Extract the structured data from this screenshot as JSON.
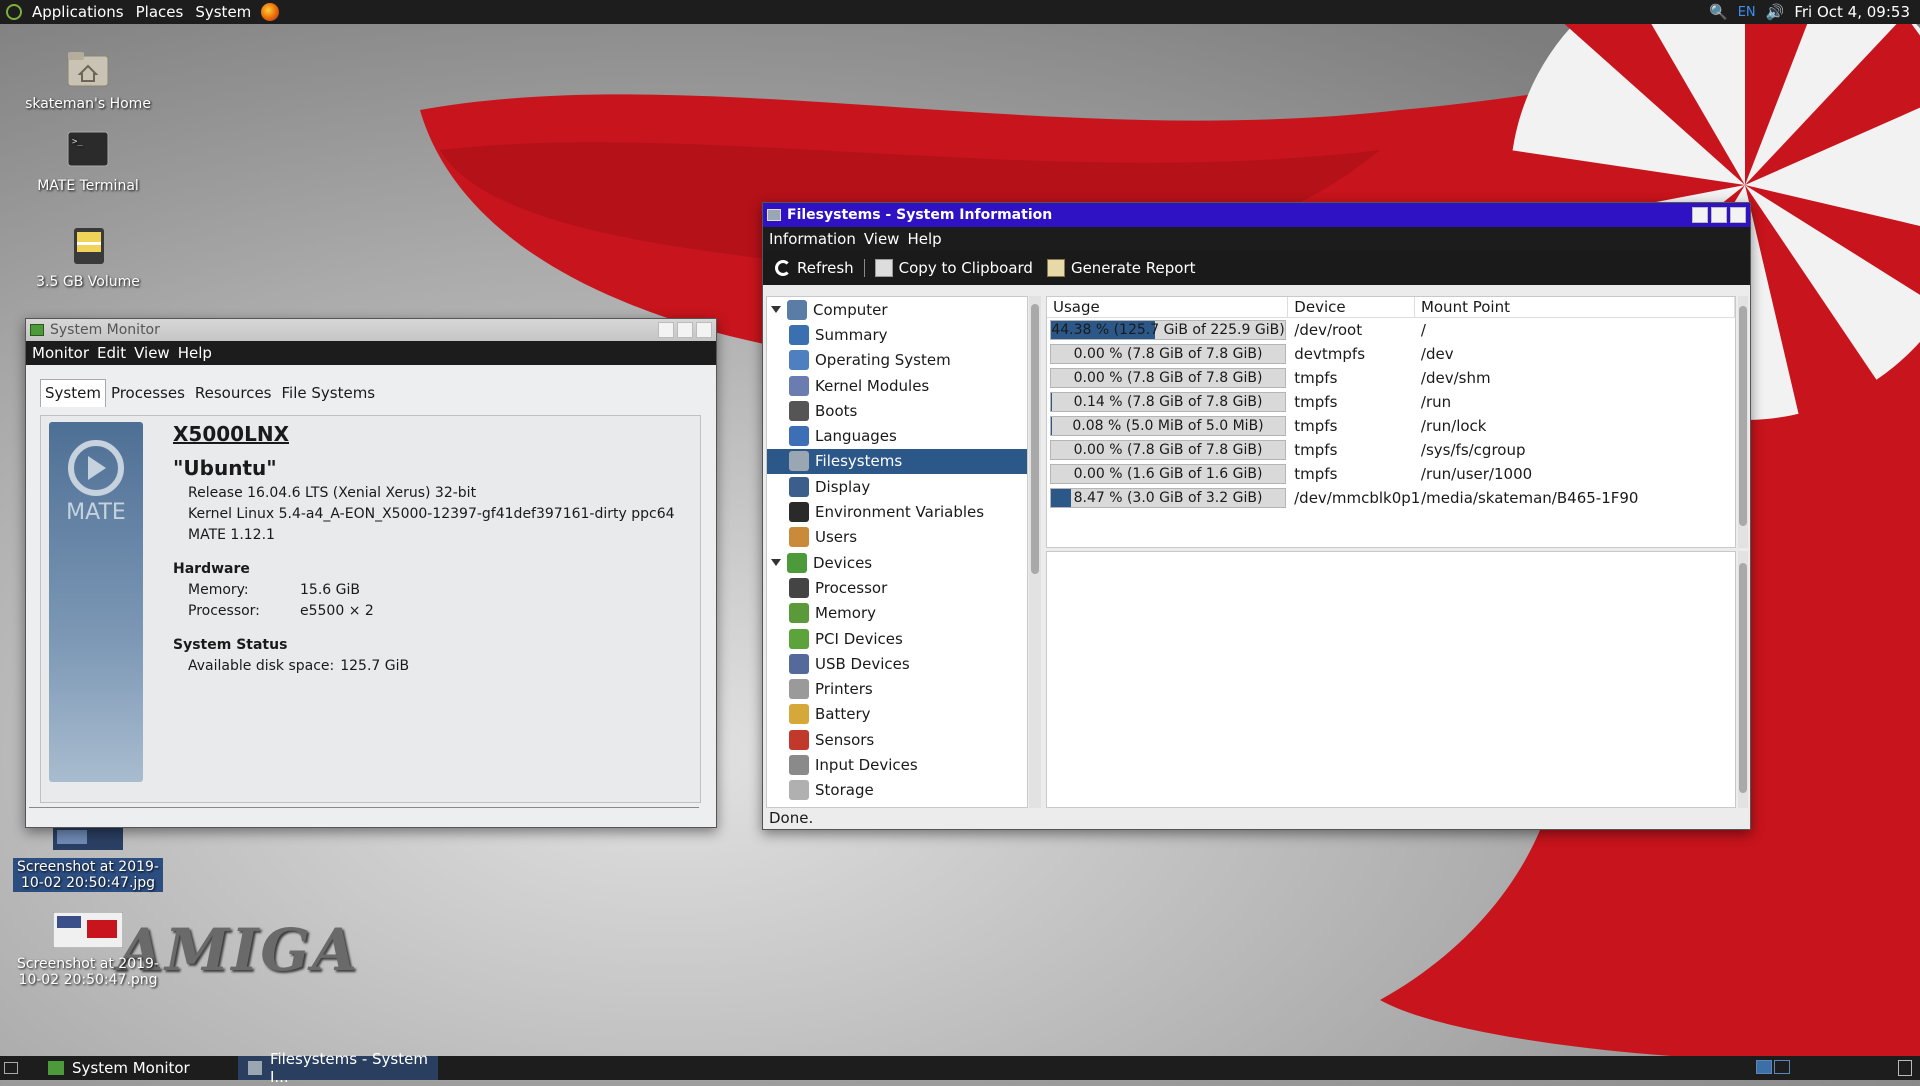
{
  "top_panel": {
    "menus": [
      "Applications",
      "Places",
      "System"
    ],
    "keyboard_layout": "EN",
    "clock": "Fri Oct  4, 09:53"
  },
  "desktop": {
    "icons": [
      {
        "label": "skateman's Home"
      },
      {
        "label": "MATE Terminal"
      },
      {
        "label": "3.5 GB Volume"
      },
      {
        "label": "Screenshot at 2019-10-02 20:50:47.jpg"
      },
      {
        "label": "Screenshot at 2019-10-02 20:50:47.png"
      }
    ],
    "wallpaper_text": "AMIGA"
  },
  "system_monitor": {
    "title": "System Monitor",
    "menu": [
      "Monitor",
      "Edit",
      "View",
      "Help"
    ],
    "tabs": [
      "System",
      "Processes",
      "Resources",
      "File Systems"
    ],
    "active_tab": "System",
    "logo_text": "MATE",
    "hostname": "X5000LNX",
    "distro": "\"Ubuntu\"",
    "release": "Release 16.04.6 LTS (Xenial Xerus) 32-bit",
    "kernel": "Kernel Linux 5.4-a4_A-EON_X5000-12397-gf41def397161-dirty ppc64",
    "mate_version": "MATE 1.12.1",
    "hardware_title": "Hardware",
    "memory_label": "Memory:",
    "memory_value": "15.6 GiB",
    "processor_label": "Processor:",
    "processor_value": "e5500 × 2",
    "status_title": "System Status",
    "disk_label": "Available disk space:",
    "disk_value": "125.7 GiB"
  },
  "system_info": {
    "title": "Filesystems - System Information",
    "menu": [
      "Information",
      "View",
      "Help"
    ],
    "toolbar": {
      "refresh": "Refresh",
      "copy": "Copy to Clipboard",
      "report": "Generate Report"
    },
    "tree": [
      {
        "label": "Computer",
        "type": "cat",
        "icon": "computer-icon",
        "color": "#5a7da6"
      },
      {
        "label": "Summary",
        "type": "child",
        "icon": "info-icon",
        "color": "#3a6fb0"
      },
      {
        "label": "Operating System",
        "type": "child",
        "icon": "gear-icon",
        "color": "#4e7fbf"
      },
      {
        "label": "Kernel Modules",
        "type": "child",
        "icon": "module-icon",
        "color": "#6b7db0"
      },
      {
        "label": "Boots",
        "type": "child",
        "icon": "power-icon",
        "color": "#555555"
      },
      {
        "label": "Languages",
        "type": "child",
        "icon": "flag-icon",
        "color": "#3d6fb6"
      },
      {
        "label": "Filesystems",
        "type": "child",
        "icon": "drive-icon",
        "color": "#9aa6b2",
        "selected": true
      },
      {
        "label": "Display",
        "type": "child",
        "icon": "monitor-icon",
        "color": "#3b5e8a"
      },
      {
        "label": "Environment Variables",
        "type": "child",
        "icon": "terminal-icon",
        "color": "#2a2a2a"
      },
      {
        "label": "Users",
        "type": "child",
        "icon": "users-icon",
        "color": "#c98a3a"
      },
      {
        "label": "Devices",
        "type": "cat",
        "icon": "board-icon",
        "color": "#4c9a3a"
      },
      {
        "label": "Processor",
        "type": "child",
        "icon": "cpu-icon",
        "color": "#444444"
      },
      {
        "label": "Memory",
        "type": "child",
        "icon": "memory-icon",
        "color": "#5a9a3a"
      },
      {
        "label": "PCI Devices",
        "type": "child",
        "icon": "pci-icon",
        "color": "#5ca33c"
      },
      {
        "label": "USB Devices",
        "type": "child",
        "icon": "usb-icon",
        "color": "#556a9a"
      },
      {
        "label": "Printers",
        "type": "child",
        "icon": "printer-icon",
        "color": "#9a9a9a"
      },
      {
        "label": "Battery",
        "type": "child",
        "icon": "battery-icon",
        "color": "#d6a83a"
      },
      {
        "label": "Sensors",
        "type": "child",
        "icon": "thermometer-icon",
        "color": "#c0392b"
      },
      {
        "label": "Input Devices",
        "type": "child",
        "icon": "keyboard-icon",
        "color": "#8a8a8a"
      },
      {
        "label": "Storage",
        "type": "child",
        "icon": "storage-icon",
        "color": "#b0b0b0"
      }
    ],
    "columns": [
      "Usage",
      "Device",
      "Mount Point"
    ],
    "rows": [
      {
        "usage": "44.38 % (125.7 GiB of 225.9 GiB)",
        "fill": 0.4438,
        "device": "/dev/root",
        "mount": "/"
      },
      {
        "usage": "0.00 % (7.8 GiB of 7.8 GiB)",
        "fill": 0.0,
        "device": "devtmpfs",
        "mount": "/dev"
      },
      {
        "usage": "0.00 % (7.8 GiB of 7.8 GiB)",
        "fill": 0.0,
        "device": "tmpfs",
        "mount": "/dev/shm"
      },
      {
        "usage": "0.14 % (7.8 GiB of 7.8 GiB)",
        "fill": 0.0014,
        "device": "tmpfs",
        "mount": "/run"
      },
      {
        "usage": "0.08 % (5.0 MiB of 5.0 MiB)",
        "fill": 0.0008,
        "device": "tmpfs",
        "mount": "/run/lock"
      },
      {
        "usage": "0.00 % (7.8 GiB of 7.8 GiB)",
        "fill": 0.0,
        "device": "tmpfs",
        "mount": "/sys/fs/cgroup"
      },
      {
        "usage": "0.00 % (1.6 GiB of 1.6 GiB)",
        "fill": 0.0,
        "device": "tmpfs",
        "mount": "/run/user/1000"
      },
      {
        "usage": "8.47 % (3.0 GiB of 3.2 GiB)",
        "fill": 0.0847,
        "device": "/dev/mmcblk0p1",
        "mount": "/media/skateman/B465-1F90"
      }
    ],
    "status": "Done."
  },
  "bottom_panel": {
    "tasks": [
      "System Monitor",
      "Filesystems - System I..."
    ]
  },
  "colors": {
    "selection": "#2c5889",
    "sysinfo_titlebar": "#2f12c4",
    "wallpaper_red": "#c8141c"
  }
}
